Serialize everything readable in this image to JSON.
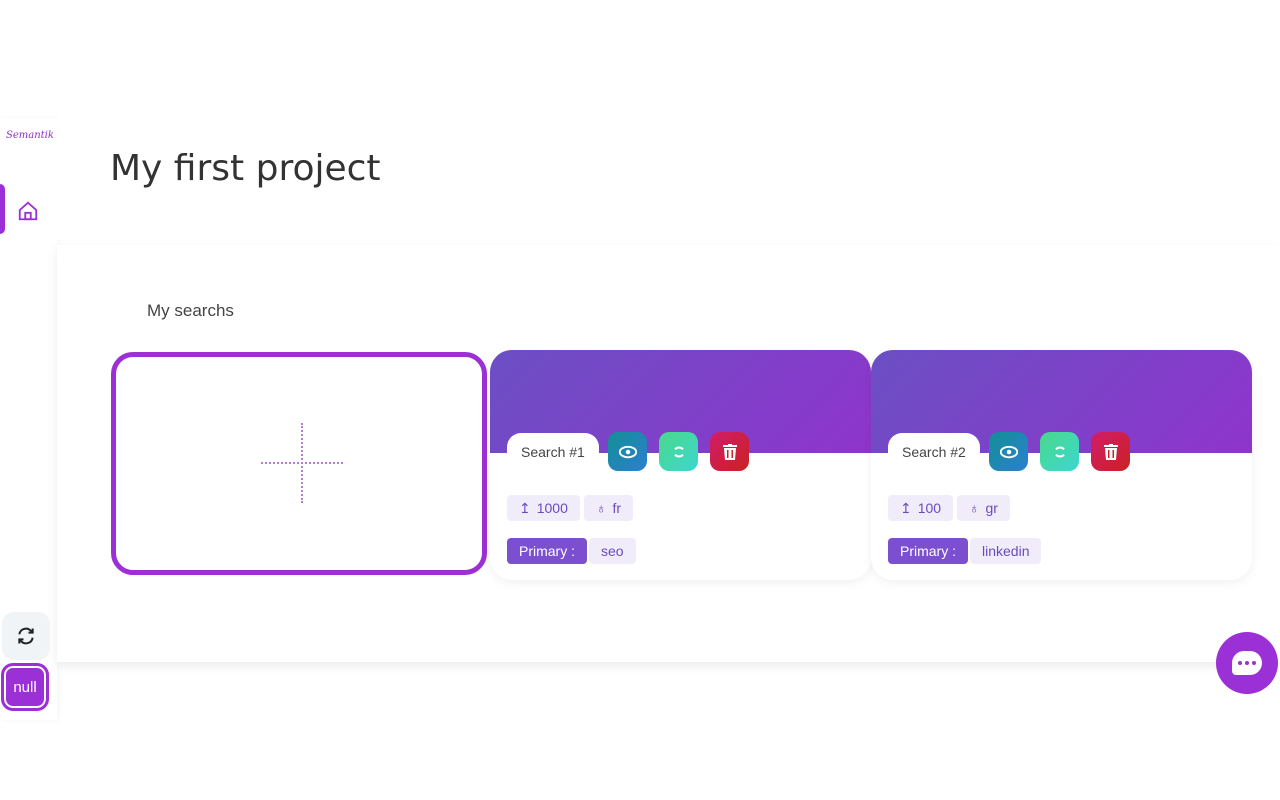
{
  "sidebar": {
    "logo": "Semantik",
    "nav": [
      {
        "icon": "home-icon",
        "active": true
      }
    ],
    "refresh_icon": "refresh-icon",
    "user_label": "null"
  },
  "header": {
    "title": "My first project"
  },
  "main": {
    "section_title": "My searchs",
    "searches": [
      {
        "name": "Search #1",
        "count": "1000",
        "lang": "fr",
        "primary_label": "Primary :",
        "primary_value": "seo"
      },
      {
        "name": "Search #2",
        "count": "100",
        "lang": "gr",
        "primary_label": "Primary :",
        "primary_value": "linkedin"
      }
    ]
  },
  "colors": {
    "accent": "#9b30d6",
    "view": "#2080c8",
    "refresh": "#40d8b0",
    "delete": "#c92222"
  }
}
